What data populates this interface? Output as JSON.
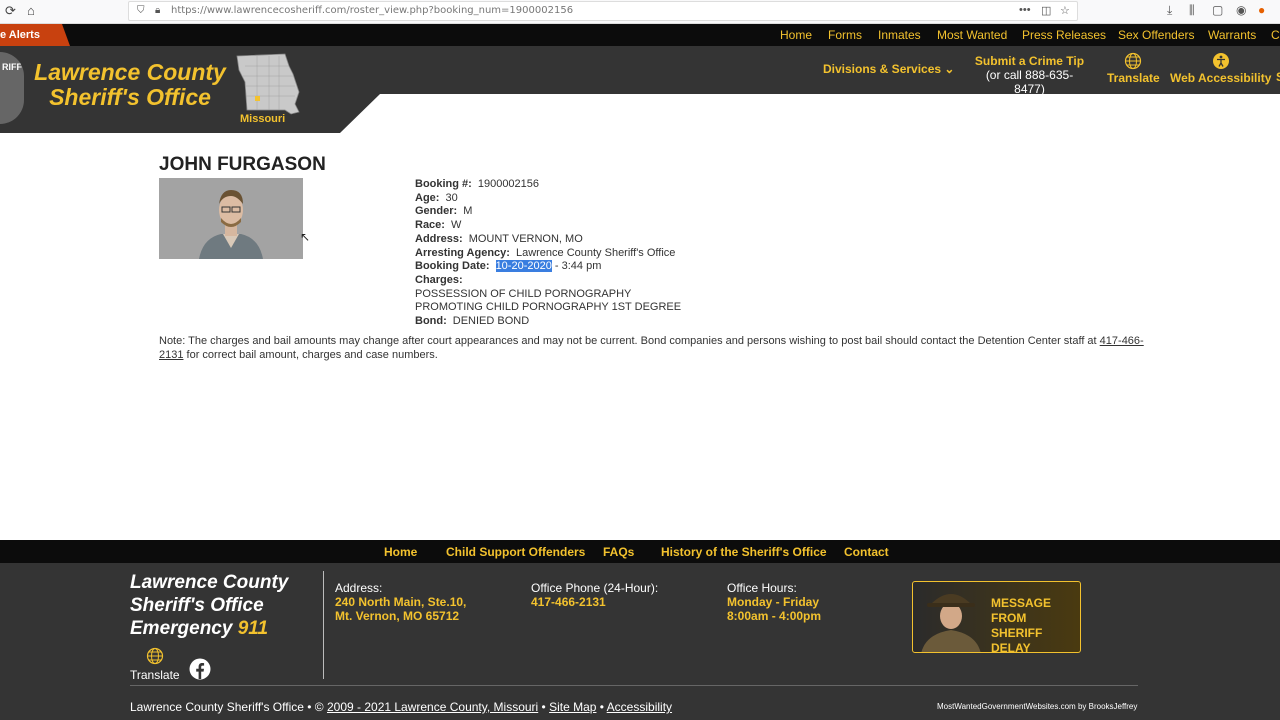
{
  "browser": {
    "url": "https://www.lawrencecosheriff.com/roster_view.php?booking_num=1900002156"
  },
  "topnav": {
    "alerts_label": "e Alerts",
    "links": [
      "Home",
      "Forms",
      "Inmates",
      "Most Wanted",
      "Press Releases",
      "Sex Offenders",
      "Warrants",
      "C"
    ]
  },
  "header": {
    "badge_text": "RIFF",
    "title_line1": "Lawrence County",
    "title_line2": "Sheriff's Office",
    "state_label": "Missouri",
    "divisions_label": "Divisions & Services",
    "tip_label": "Submit a Crime Tip",
    "tip_phone": "(or call 888-635-8477)",
    "translate_label": "Translate",
    "accessibility_label": "Web Accessibility",
    "overflow_label": "S"
  },
  "inmate": {
    "name": "JOHN FURGASON",
    "booking_label": "Booking #:",
    "booking_num": "1900002156",
    "age_label": "Age:",
    "age": "30",
    "gender_label": "Gender:",
    "gender": "M",
    "race_label": "Race:",
    "race": "W",
    "address_label": "Address:",
    "address": "MOUNT VERNON, MO",
    "agency_label": "Arresting Agency:",
    "agency": "Lawrence County Sheriff's Office",
    "booking_date_label": "Booking Date:",
    "booking_date": "10-20-2020",
    "booking_time": " - 3:44 pm",
    "charges_label": "Charges:",
    "charges": [
      "POSSESSION OF CHILD PORNOGRAPHY",
      "PROMOTING CHILD PORNOGRAPHY 1ST DEGREE"
    ],
    "bond_label": "Bond:",
    "bond": "DENIED BOND"
  },
  "note": {
    "text1": "Note: The charges and bail amounts may change after court appearances and may not be current. Bond companies and persons wishing to post bail should contact the Detention Center staff at ",
    "phone": "417-466-2131",
    "text2": " for correct bail amount, charges and case numbers."
  },
  "footnav": {
    "links": [
      "Home",
      "Child Support Offenders",
      "FAQs",
      "History of the Sheriff's Office",
      "Contact"
    ]
  },
  "footer": {
    "title_line1": "Lawrence County",
    "title_line2": "Sheriff's Office",
    "title_line3a": "Emergency ",
    "title_line3b": "911",
    "translate_label": "Translate",
    "address_head": "Address:",
    "address_line1": "240 North Main, Ste.10,",
    "address_line2": "Mt. Vernon, MO 65712",
    "phone_head": "Office Phone (24-Hour):",
    "phone": "417-466-2131",
    "hours_head": "Office Hours:",
    "hours_days": "Monday - Friday",
    "hours_time": "8:00am - 4:00pm",
    "message_line1": "MESSAGE FROM",
    "message_line2": "SHERIFF DELAY",
    "copy_prefix": "Lawrence County Sheriff's Office • © ",
    "copy_link": "2009 - 2021 Lawrence County, Missouri",
    "sep": " • ",
    "sitemap": "Site Map",
    "accessibility": "Accessibility",
    "credit": "MostWantedGovernmentWebsites.com by BrooksJeffrey"
  },
  "colors": {
    "accent": "#f3c22e",
    "dark": "#343434",
    "alert": "#c8410f"
  }
}
